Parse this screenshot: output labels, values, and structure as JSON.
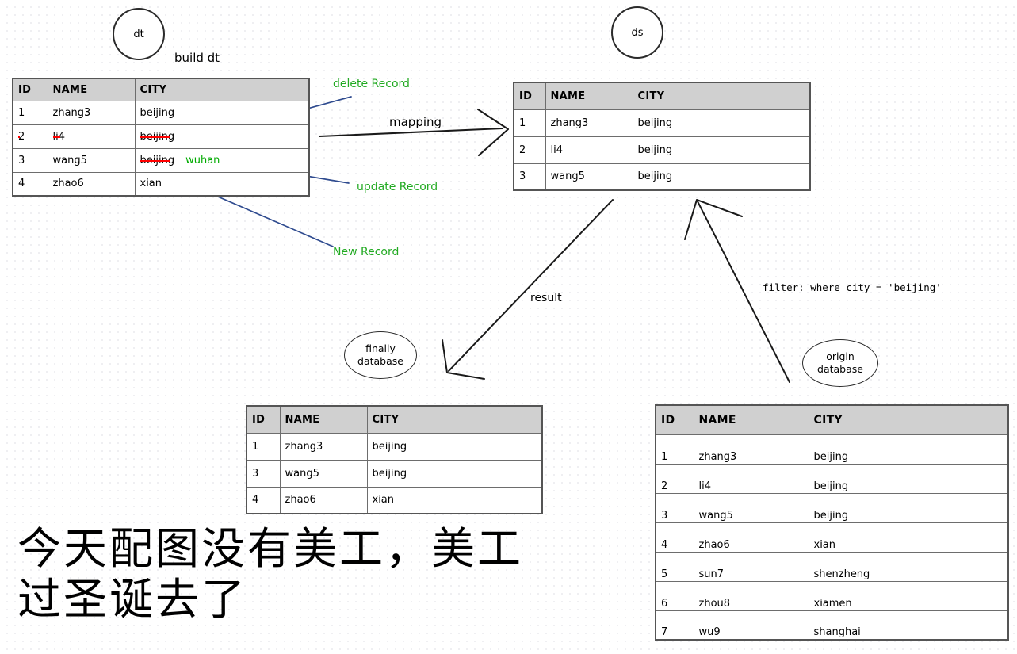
{
  "nodes": {
    "dt": "dt",
    "ds": "ds",
    "finally_line1": "finally",
    "finally_line2": "database",
    "origin_line1": "origin",
    "origin_line2": "database"
  },
  "labels": {
    "build_dt": "build dt",
    "mapping": "mapping",
    "delete_record": "delete Record",
    "update_record": "update Record",
    "new_record": "New Record",
    "result": "result",
    "filter": "filter: where city = 'beijing'"
  },
  "caption": "今天配图没有美工，美工过圣诞去了",
  "colors": {
    "annotation_green": "#22aa22",
    "strike_red": "#ff0000",
    "arrow_blue": "#2f4b8f",
    "arrow_black": "#1a1a1a",
    "header_gray": "#d0d0d0"
  },
  "tables": {
    "dt": {
      "name": "dt",
      "columns": [
        "ID",
        "NAME",
        "CITY"
      ],
      "rows": [
        {
          "id": "1",
          "name": "zhang3",
          "city": "beijing",
          "state": "unchanged"
        },
        {
          "id": "2",
          "name": "li4",
          "city": "beijing",
          "state": "deleted"
        },
        {
          "id": "3",
          "name": "wang5",
          "city": "beijing",
          "city_new": "wuhan",
          "state": "updated"
        },
        {
          "id": "4",
          "name": "zhao6",
          "city": "xian",
          "state": "new"
        }
      ]
    },
    "ds": {
      "name": "ds",
      "columns": [
        "ID",
        "NAME",
        "CITY"
      ],
      "rows": [
        {
          "id": "1",
          "name": "zhang3",
          "city": "beijing"
        },
        {
          "id": "2",
          "name": "li4",
          "city": "beijing"
        },
        {
          "id": "3",
          "name": "wang5",
          "city": "beijing"
        }
      ]
    },
    "finally": {
      "name": "finally database",
      "columns": [
        "ID",
        "NAME",
        "CITY"
      ],
      "rows": [
        {
          "id": "1",
          "name": "zhang3",
          "city": "beijing"
        },
        {
          "id": "3",
          "name": "wang5",
          "city": "beijing"
        },
        {
          "id": "4",
          "name": "zhao6",
          "city": "xian"
        }
      ]
    },
    "origin": {
      "name": "origin database",
      "columns": [
        "ID",
        "NAME",
        "CITY"
      ],
      "rows": [
        {
          "id": "1",
          "name": "zhang3",
          "city": "beijing"
        },
        {
          "id": "2",
          "name": "li4",
          "city": "beijing"
        },
        {
          "id": "3",
          "name": "wang5",
          "city": "beijing"
        },
        {
          "id": "4",
          "name": "zhao6",
          "city": "xian"
        },
        {
          "id": "5",
          "name": "sun7",
          "city": "shenzheng"
        },
        {
          "id": "6",
          "name": "zhou8",
          "city": "xiamen"
        },
        {
          "id": "7",
          "name": "wu9",
          "city": "shanghai"
        }
      ]
    }
  }
}
